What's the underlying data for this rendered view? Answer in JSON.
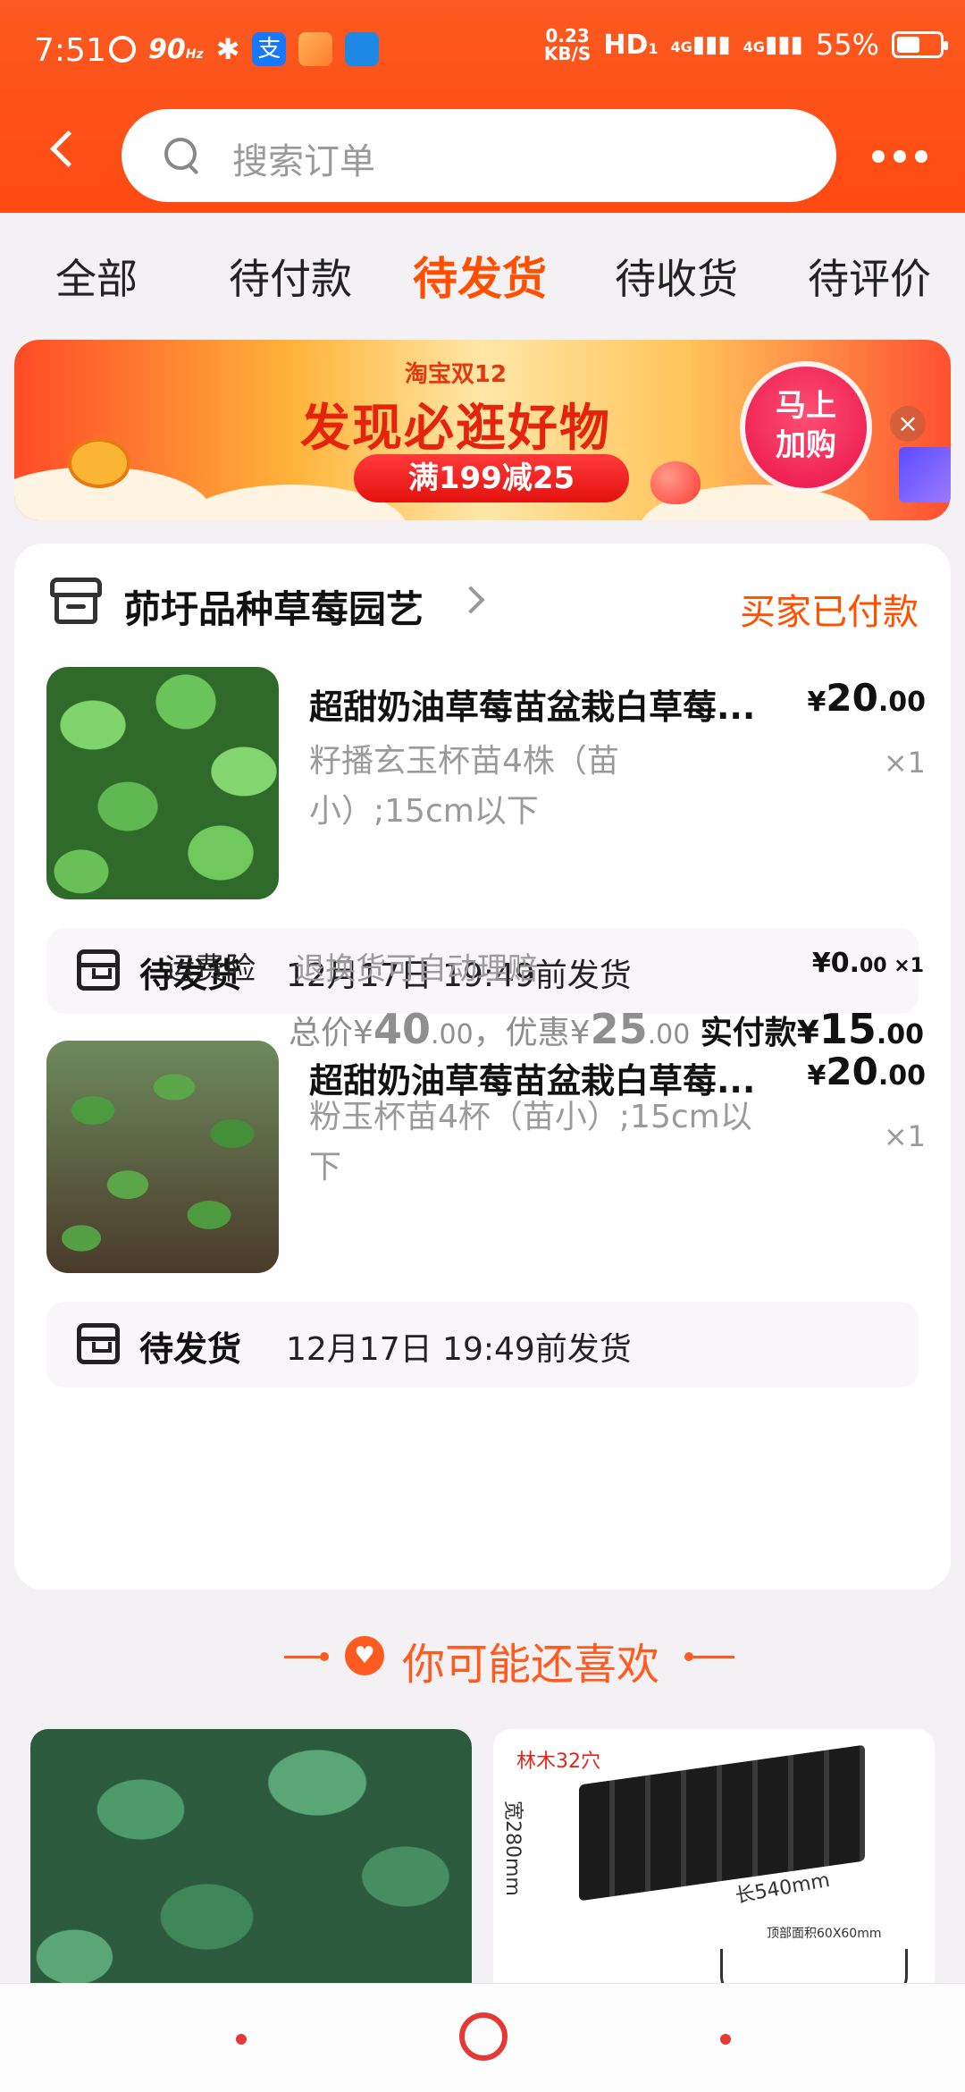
{
  "status_bar": {
    "time": "7:51",
    "refresh_rate": "90",
    "refresh_unit": "Hz",
    "net_speed_value": "0.23",
    "net_speed_unit": "KB/S",
    "hd_label": "HD",
    "hd_sub": "1",
    "signal1": "4G",
    "signal2": "4G",
    "battery_text": "55%",
    "battery_level": 0.55
  },
  "header": {
    "search_placeholder": "搜索订单"
  },
  "tabs": [
    {
      "label": "全部",
      "active": false
    },
    {
      "label": "待付款",
      "active": false
    },
    {
      "label": "待发货",
      "active": true
    },
    {
      "label": "待收货",
      "active": false
    },
    {
      "label": "待评价",
      "active": false
    }
  ],
  "banner": {
    "brand": "淘宝双12",
    "title": "发现必逛好物",
    "pill": "满199减25",
    "cta_line1": "马上",
    "cta_line2": "加购",
    "close": "×"
  },
  "order": {
    "shop_name": "茆圩品种草莓园艺",
    "status": "买家已付款",
    "items": [
      {
        "title": "超甜奶油草莓苗盆栽白草莓...",
        "sku_line1": "籽播玄玉杯苗4株（苗",
        "sku_line2": "小）;15cm以下",
        "price_currency": "¥",
        "price_int": "20",
        "price_dec": ".00",
        "qty": "×1",
        "ship_label": "待发货",
        "ship_deadline": "12月17日 19:49前发货"
      },
      {
        "title": "超甜奶油草莓苗盆栽白草莓...",
        "sku_line1": "粉玉杯苗4杯（苗小）;15cm以",
        "sku_line2": "下",
        "price_currency": "¥",
        "price_int": "20",
        "price_dec": ".00",
        "qty": "×1",
        "ship_label": "待发货",
        "ship_deadline": "12月17日 19:49前发货"
      }
    ],
    "insurance": {
      "label": "运费险",
      "desc": "退换货可自动理赔",
      "price": "¥0.",
      "price_dec": "00 ×1"
    },
    "totals": {
      "total_label": "总价¥",
      "total_int": "40",
      "total_dec": ".00",
      "discount_label": "，优惠¥",
      "discount_int": "25",
      "discount_dec": ".00",
      "paid_label": "实付款¥",
      "paid_int": "15",
      "paid_dec": ".00"
    }
  },
  "recommend": {
    "title": "你可能还喜欢",
    "tray_tag": "林木32穴",
    "tray_width": "宽280mm",
    "tray_length": "长540mm",
    "tray_top": "顶部面积60X60mm"
  },
  "colors": {
    "accent": "#ff5000",
    "header_bg": "#ff4a12",
    "nav_red": "#e53935"
  }
}
